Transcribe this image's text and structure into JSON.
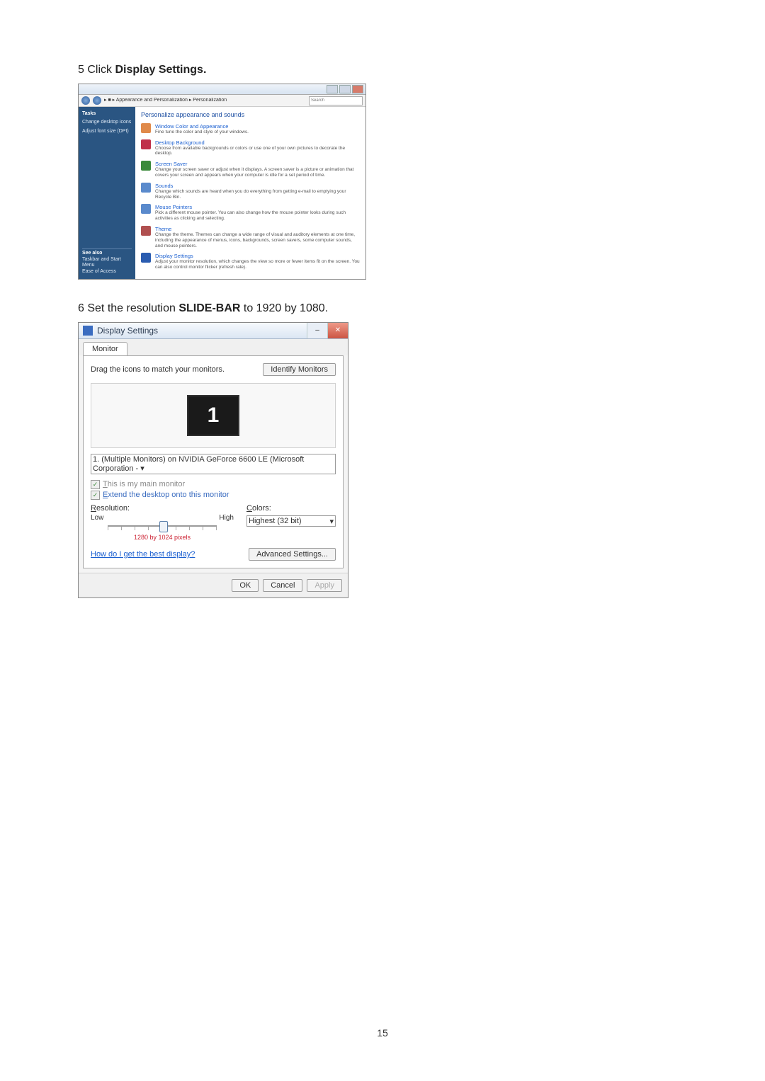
{
  "steps": {
    "s5_num": "5",
    "s5_prefix": " Click ",
    "s5_bold": "Display Settings.",
    "s6_num": "6",
    "s6_prefix": " Set the resolution ",
    "s6_bold": "SLIDE-BAR",
    "s6_suffix": " to 1920  by 1080."
  },
  "fig1": {
    "breadcrumb": "▸ ■ ▸ Appearance and Personalization ▸ Personalization",
    "search_ph": "Search",
    "sidebar": {
      "tasks": "Tasks",
      "item1": "Change desktop icons",
      "item2": "Adjust font size (DPI)",
      "seealso": "See also",
      "bottom1": "Taskbar and Start Menu",
      "bottom2": "Ease of Access"
    },
    "heading": "Personalize appearance and sounds",
    "entries": [
      {
        "t": "Window Color and Appearance",
        "d": "Fine tune the color and style of your windows."
      },
      {
        "t": "Desktop Background",
        "d": "Choose from available backgrounds or colors or use one of your own pictures to decorate the desktop."
      },
      {
        "t": "Screen Saver",
        "d": "Change your screen saver or adjust when it displays. A screen saver is a picture or animation that covers your screen and appears when your computer is idle for a set period of time."
      },
      {
        "t": "Sounds",
        "d": "Change which sounds are heard when you do everything from getting e-mail to emptying your Recycle Bin."
      },
      {
        "t": "Mouse Pointers",
        "d": "Pick a different mouse pointer. You can also change how the mouse pointer looks during such activities as clicking and selecting."
      },
      {
        "t": "Theme",
        "d": "Change the theme. Themes can change a wide range of visual and auditory elements at one time, including the appearance of menus, icons, backgrounds, screen savers, some computer sounds, and mouse pointers."
      },
      {
        "t": "Display Settings",
        "d": "Adjust your monitor resolution, which changes the view so more or fewer items fit on the screen. You can also control monitor flicker (refresh rate)."
      }
    ]
  },
  "fig2": {
    "title": "Display Settings",
    "tab": "Monitor",
    "drag_text": "Drag the icons to match your monitors.",
    "identify": "Identify Monitors",
    "monitor_number": "1",
    "monitor_select": "1. (Multiple Monitors) on NVIDIA GeForce 6600 LE (Microsoft Corporation -  ▾",
    "chk_main": "This is my main monitor",
    "chk_extend": "Extend the desktop onto this monitor",
    "resolution_label": "Resolution:",
    "low": "Low",
    "high": "High",
    "slider_caption": "1280 by 1024 pixels",
    "colors_label": "Colors:",
    "colors_value": "Highest (32 bit)",
    "help_link": "How do I get the best display?",
    "advanced": "Advanced Settings...",
    "ok": "OK",
    "cancel": "Cancel",
    "apply": "Apply"
  },
  "page_number": "15"
}
